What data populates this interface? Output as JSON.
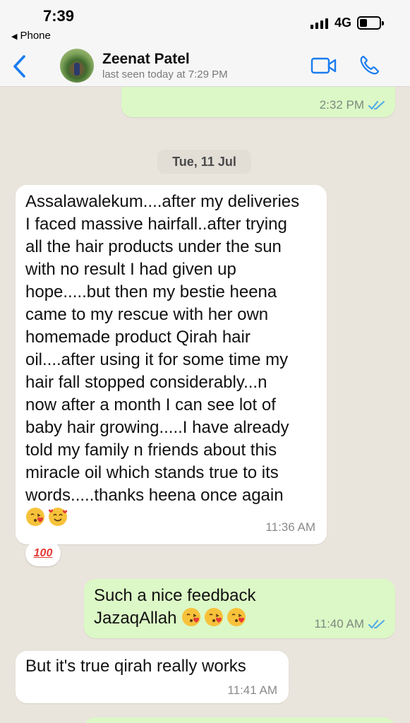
{
  "status_bar": {
    "time": "7:39",
    "back_app": "Phone",
    "network": "4G"
  },
  "header": {
    "contact_name": "Zeenat Patel",
    "last_seen": "last seen today at 7:29 PM"
  },
  "messages": {
    "m0": {
      "time": "2:32 PM",
      "status": "read"
    },
    "date_separator": "Tue, 11 Jul",
    "m1": {
      "lines": [
        "Assalawalekum....after my deliveries",
        "I faced massive hairfall..after trying",
        "all the hair products under the sun",
        "with no result I had given up",
        "hope.....but then  my bestie heena",
        "came to my rescue with her own",
        "homemade product Qirah hair",
        "oil....after using it for some time my",
        "hair fall stopped considerably...n",
        "now after a month I can see lot of",
        "baby hair growing.....I have already",
        "told my family n friends about this",
        "miracle oil which stands true to its",
        "words.....thanks heena once again"
      ],
      "time": "11:36 AM",
      "reaction": "100"
    },
    "m2": {
      "lines": [
        "Such a nice feedback",
        "JazaqAllah"
      ],
      "time": "11:40 AM",
      "status": "read"
    },
    "m3": {
      "text": "But it's true qirah really works",
      "time": "11:41 AM"
    }
  },
  "colors": {
    "accent_blue": "#1a7cf0",
    "outgoing_bubble": "#dcf8c6",
    "incoming_bubble": "#ffffff",
    "chat_bg": "#e9e4dc",
    "read_ticks": "#4fa8e8"
  }
}
